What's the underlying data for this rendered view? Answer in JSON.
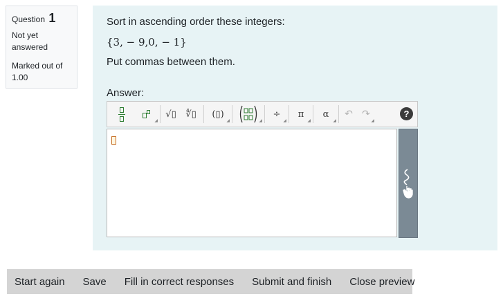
{
  "question": {
    "label": "Question",
    "number": "1",
    "state": "Not yet answered",
    "grade": "Marked out of 1.00"
  },
  "content": {
    "text_line1": "Sort in ascending order these integers:",
    "set": "{3, − 9,0, − 1}",
    "text_line3": "Put commas between them.",
    "answer_label": "Answer:"
  },
  "toolbar": {
    "buttons": [
      "fraction",
      "superscript",
      "square-root",
      "nth-root",
      "parentheses",
      "matrix",
      "divide",
      "pi",
      "alpha",
      "undo",
      "redo",
      "help"
    ],
    "sqrt_label": "√▯",
    "nroot_label": "∜▯",
    "paren_label": "(▯)",
    "divide_label": "÷",
    "pi_label": "π",
    "alpha_label": "α",
    "undo_label": "↶",
    "redo_label": "↷",
    "help_label": "?"
  },
  "actions": {
    "start_again": "Start again",
    "save": "Save",
    "fill": "Fill in correct responses",
    "submit": "Submit and finish",
    "close": "Close preview"
  }
}
